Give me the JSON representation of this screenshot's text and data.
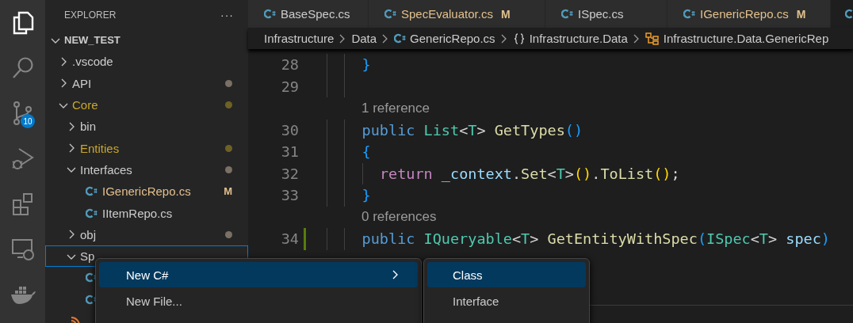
{
  "activity_bar": [
    {
      "kind": "files",
      "selected": true
    },
    {
      "kind": "search",
      "selected": false
    },
    {
      "kind": "source-control",
      "selected": false,
      "badge": "10"
    },
    {
      "kind": "run-debug",
      "selected": false
    },
    {
      "kind": "extensions",
      "selected": false
    },
    {
      "kind": "remote",
      "selected": false
    },
    {
      "kind": "docker",
      "selected": false
    }
  ],
  "sidebar": {
    "title": "EXPLORER",
    "more": "···",
    "tree": [
      {
        "label": "NEW_TEST",
        "kind": "root",
        "expanded": true,
        "children": [
          {
            "label": ".vscode",
            "kind": "folder",
            "expanded": false,
            "color": "#cccccc"
          },
          {
            "label": "API",
            "kind": "folder",
            "expanded": false,
            "color": "#cccccc",
            "decoration": {
              "kind": "dot",
              "color": "#7a7064"
            }
          },
          {
            "label": "Core",
            "kind": "folder",
            "expanded": true,
            "color": "#c9a72a",
            "decoration": {
              "kind": "dot",
              "color": "#6e6124"
            },
            "children": [
              {
                "label": "bin",
                "kind": "folder",
                "expanded": false,
                "color": "#cccccc"
              },
              {
                "label": "Entities",
                "kind": "folder",
                "expanded": false,
                "color": "#c9a72a",
                "decoration": {
                  "kind": "dot",
                  "color": "#6e6124"
                }
              },
              {
                "label": "Interfaces",
                "kind": "folder",
                "expanded": true,
                "color": "#cccccc",
                "decoration": {
                  "kind": "dot",
                  "color": "#7a7064"
                },
                "children": [
                  {
                    "label": "IGenericRepo.cs",
                    "kind": "csharp",
                    "color": "#e2c08d",
                    "decoration": {
                      "kind": "letter",
                      "text": "M",
                      "color": "#e2c08d"
                    }
                  },
                  {
                    "label": "IItemRepo.cs",
                    "kind": "csharp",
                    "color": "#cccccc"
                  }
                ]
              },
              {
                "label": "obj",
                "kind": "folder",
                "expanded": false,
                "color": "#cccccc",
                "decoration": {
                  "kind": "dot",
                  "color": "#7a7064"
                }
              },
              {
                "label": "Sp",
                "kind": "folder",
                "expanded": true,
                "focused": true,
                "color": "#cccccc",
                "children": [
                  {
                    "kind": "csharp"
                  },
                  {
                    "kind": "csharp"
                  }
                ]
              }
            ]
          },
          {
            "kind": "feed"
          }
        ]
      }
    ]
  },
  "tabs": [
    {
      "label": "BaseSpec.cs",
      "selected": false,
      "color": "#cccccc"
    },
    {
      "label": "SpecEvaluator.cs",
      "selected": false,
      "color": "#e2c08d",
      "badge": "M"
    },
    {
      "label": "ISpec.cs",
      "selected": false,
      "color": "#cccccc"
    },
    {
      "label": "IGenericRepo.cs",
      "selected": false,
      "color": "#e2c08d",
      "badge": "M"
    },
    {
      "selected": true
    }
  ],
  "breadcrumbs": [
    {
      "label": "Infrastructure",
      "kind": "folder"
    },
    {
      "label": "Data",
      "kind": "folder"
    },
    {
      "label": "GenericRepo.cs",
      "kind": "csharp"
    },
    {
      "label": "Infrastructure.Data",
      "kind": "namespace"
    },
    {
      "label": "Infrastructure.Data.GenericRep",
      "kind": "class"
    }
  ],
  "editor": {
    "lines": [
      {
        "kind": "code",
        "number": "28",
        "modified": false,
        "guides": [
          {
            "kind": "guide"
          },
          {
            "kind": "guide"
          }
        ],
        "tokens": [
          {
            "text": "}",
            "kind": "bracket-blue"
          }
        ]
      },
      {
        "kind": "code",
        "number": "29",
        "modified": false,
        "guides": [
          {
            "kind": "guide"
          },
          {
            "kind": "guide"
          }
        ]
      },
      {
        "kind": "codelens",
        "text": "1 reference"
      },
      {
        "kind": "code",
        "number": "30",
        "modified": false,
        "guides": [
          {
            "kind": "guide"
          },
          {
            "kind": "guide"
          }
        ],
        "tokens": [
          {
            "text": "public ",
            "kind": "keyword"
          },
          {
            "text": "List",
            "kind": "type"
          },
          {
            "text": "<",
            "kind": "punct"
          },
          {
            "text": "T",
            "kind": "type"
          },
          {
            "text": "> ",
            "kind": "punct"
          },
          {
            "text": "GetTypes",
            "kind": "method"
          },
          {
            "text": "()",
            "kind": "bracket-blue"
          }
        ]
      },
      {
        "kind": "code",
        "number": "31",
        "modified": false,
        "guides": [
          {
            "kind": "guide"
          },
          {
            "kind": "guide"
          }
        ],
        "tokens": [
          {
            "text": "{",
            "kind": "bracket-blue"
          }
        ]
      },
      {
        "kind": "code",
        "number": "32",
        "modified": false,
        "guides": [
          {
            "kind": "guide"
          },
          {
            "kind": "guide"
          },
          {
            "kind": "guide"
          }
        ],
        "tokens": [
          {
            "text": "return ",
            "kind": "control"
          },
          {
            "text": "_context",
            "kind": "variable"
          },
          {
            "text": ".",
            "kind": "punct"
          },
          {
            "text": "Set",
            "kind": "method"
          },
          {
            "text": "<",
            "kind": "punct"
          },
          {
            "text": "T",
            "kind": "type"
          },
          {
            "text": ">",
            "kind": "punct"
          },
          {
            "text": "()",
            "kind": "bracket-gold"
          },
          {
            "text": ".",
            "kind": "punct"
          },
          {
            "text": "ToList",
            "kind": "method"
          },
          {
            "text": "()",
            "kind": "bracket-gold"
          },
          {
            "text": ";",
            "kind": "punct"
          }
        ]
      },
      {
        "kind": "code",
        "number": "33",
        "modified": false,
        "guides": [
          {
            "kind": "guide"
          },
          {
            "kind": "guide"
          }
        ],
        "tokens": [
          {
            "text": "}",
            "kind": "bracket-blue"
          }
        ]
      },
      {
        "kind": "codelens",
        "text": "0 references"
      },
      {
        "kind": "code",
        "number": "34",
        "modified": true,
        "guides": [
          {
            "kind": "guide"
          },
          {
            "kind": "guide"
          }
        ],
        "tokens": [
          {
            "text": "public ",
            "kind": "keyword"
          },
          {
            "text": "IQueryable",
            "kind": "type"
          },
          {
            "text": "<",
            "kind": "punct"
          },
          {
            "text": "T",
            "kind": "type"
          },
          {
            "text": "> ",
            "kind": "punct"
          },
          {
            "text": "GetEntityWithSpec",
            "kind": "method"
          },
          {
            "text": "(",
            "kind": "bracket-blue"
          },
          {
            "text": "ISpec",
            "kind": "type"
          },
          {
            "text": "<",
            "kind": "punct"
          },
          {
            "text": "T",
            "kind": "type"
          },
          {
            "text": "> ",
            "kind": "punct"
          },
          {
            "text": "spec",
            "kind": "variable"
          },
          {
            "text": ")",
            "kind": "bracket-blue"
          }
        ]
      }
    ]
  },
  "context_menu": {
    "items": [
      {
        "label": "New C#",
        "selected": true,
        "submenu": true
      },
      {
        "label": "New File...",
        "selected": false,
        "submenu": false
      }
    ],
    "submenu": {
      "items": [
        {
          "label": "Class",
          "selected": true
        },
        {
          "label": "Interface",
          "selected": false
        }
      ]
    }
  }
}
